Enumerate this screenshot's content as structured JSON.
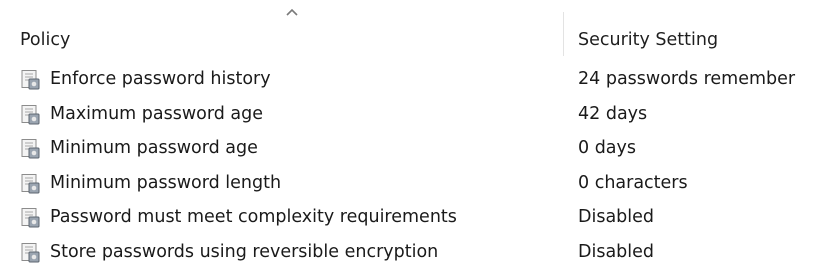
{
  "header": {
    "columns": [
      {
        "label": "Policy",
        "sorted": "ascending"
      },
      {
        "label": "Security Setting"
      }
    ]
  },
  "rows": [
    {
      "icon": "policy-setting-icon",
      "policy": "Enforce password history",
      "setting": "24 passwords remember"
    },
    {
      "icon": "policy-setting-icon",
      "policy": "Maximum password age",
      "setting": "42 days"
    },
    {
      "icon": "policy-setting-icon",
      "policy": "Minimum password age",
      "setting": "0 days"
    },
    {
      "icon": "policy-setting-icon",
      "policy": "Minimum password length",
      "setting": "0 characters"
    },
    {
      "icon": "policy-setting-icon",
      "policy": "Password must meet complexity requirements",
      "setting": "Disabled"
    },
    {
      "icon": "policy-setting-icon",
      "policy": "Store passwords using reversible encryption",
      "setting": "Disabled"
    }
  ]
}
